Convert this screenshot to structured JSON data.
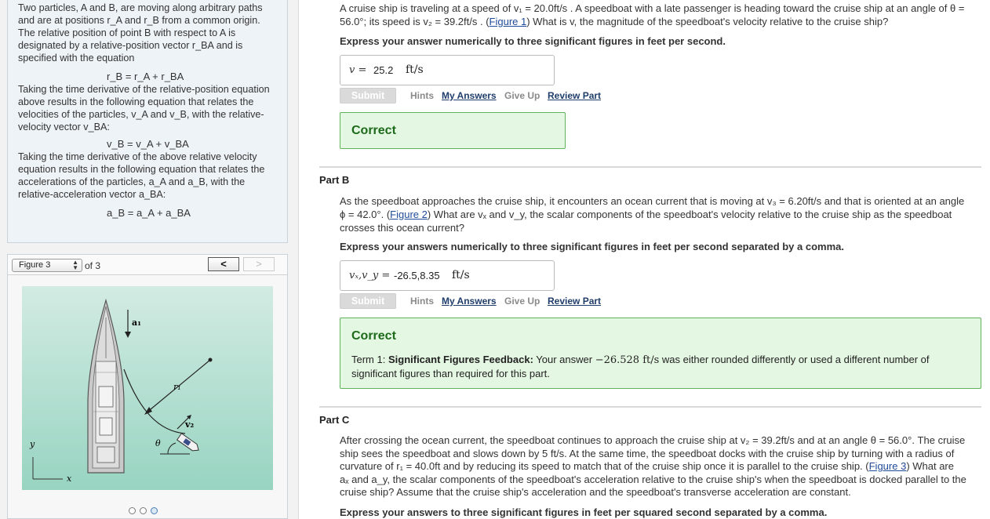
{
  "intro": {
    "p1": "Two particles, A and B, are moving along arbitrary paths and are at positions r_A and r_B from a common origin. The relative position of point B with respect to A is designated by a relative-position vector r_BA and is specified with the equation",
    "eq1": "r_B = r_A + r_BA",
    "p2": "Taking the time derivative of the relative-position equation above results in the following equation that relates the velocities of the particles, v_A and v_B, with the relative-velocity vector v_BA:",
    "eq2": "v_B = v_A + v_BA",
    "p3": "Taking the time derivative of the above relative velocity equation results in the following equation that relates the accelerations of the particles, a_A and a_B, with the relative-acceleration vector a_BA:",
    "eq3": "a_B = a_A + a_BA"
  },
  "figure_viewer": {
    "selected": "Figure 3",
    "of_label": "of 3",
    "prev_label": "<",
    "next_label": ">",
    "labels": {
      "a1": "a₁",
      "r1": "r₁",
      "v2": "v₂",
      "theta": "θ",
      "y": "y",
      "x": "x"
    },
    "dot_count": 3,
    "active_dot": 3
  },
  "part_a": {
    "question_1": "A cruise ship is traveling at a speed of v₁ = 20.0ft/s . A speedboat with a late passenger is heading toward the cruise ship at an angle of θ =",
    "question_2": "56.0°; its speed is v₂ = 39.2ft/s . (",
    "figure_link": "Figure 1",
    "question_3": ") What is v, the magnitude of the speedboat's velocity relative to the cruise ship?",
    "instruction": "Express your answer numerically to three significant figures in feet per second.",
    "answer_label": "v =",
    "answer_value": "25.2",
    "answer_unit": "ft/s",
    "submit_label": "Submit",
    "hints_label": "Hints",
    "my_answers_label": "My Answers",
    "give_up_label": "Give Up",
    "review_label": "Review Part",
    "feedback_title": "Correct"
  },
  "part_b": {
    "title": "Part B",
    "question_1": "As the speedboat approaches the cruise ship, it encounters an ocean current that is moving at v₃ = 6.20ft/s and that is oriented at an angle",
    "question_2": "ϕ = 42.0°. (",
    "figure_link": "Figure 2",
    "question_3": ") What are vₓ and v_y, the scalar components of the speedboat's velocity relative to the cruise ship as the speedboat",
    "question_4": "crosses this ocean current?",
    "instruction": "Express your answers numerically to three significant figures in feet per second separated by a comma.",
    "answer_label": "vₓ,v_y =",
    "answer_value": "-26.5,8.35",
    "answer_unit": "ft/s",
    "submit_label": "Submit",
    "hints_label": "Hints",
    "my_answers_label": "My Answers",
    "give_up_label": "Give Up",
    "review_label": "Review Part",
    "feedback_title": "Correct",
    "feedback_prefix": "Term 1: ",
    "feedback_bold": "Significant Figures Feedback:",
    "feedback_1": " Your answer ",
    "feedback_value": "−26.528 ft/s",
    "feedback_2": " was either rounded differently or used a different number of",
    "feedback_3": "significant figures than required for this part."
  },
  "part_c": {
    "title": "Part C",
    "line_1": "After crossing the ocean current, the speedboat continues to approach the cruise ship at v₂ = 39.2ft/s and at an angle θ = 56.0°. The cruise",
    "line_2": "ship sees the speedboat and slows down by 5 ft/s. At the same time, the speedboat docks with the cruise ship by turning with a radius of",
    "line_3a": "curvature of r₁ = 40.0ft and by reducing its speed to match that of the cruise ship once it is parallel to the cruise ship. (",
    "figure_link": "Figure 3",
    "line_3b": ") What are",
    "line_4": "aₓ and a_y, the scalar components of the speedboat's acceleration relative to the cruise ship's when the speedboat is docked parallel to the",
    "line_5": "cruise ship? Assume that the cruise ship's acceleration and the speedboat's transverse acceleration are constant.",
    "instruction": "Express your answers to three significant figures in feet per squared second separated by a comma."
  }
}
